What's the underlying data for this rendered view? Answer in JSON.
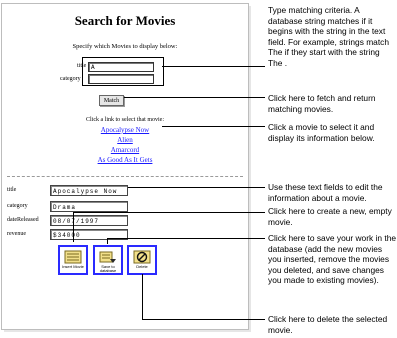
{
  "form": {
    "title": "Search for Movies",
    "specify_text": "Specify which Movies to display below:",
    "title_label": "title",
    "title_value": "A",
    "category_label": "category",
    "category_value": "",
    "match_label": "Match",
    "click_link_text": "Click a link to select that movie:",
    "movies": [
      "Apocalypse Now",
      "Alien",
      "Amarcord",
      "As Good As It Gets"
    ]
  },
  "details": {
    "fields": [
      {
        "label": "title",
        "value": "Apocalypse Now"
      },
      {
        "label": "category",
        "value": "Drama"
      },
      {
        "label": "dateReleased",
        "value": "08/07/1997"
      },
      {
        "label": "revenue",
        "value": "$34000"
      }
    ],
    "buttons": [
      {
        "caption": "Insert Movie",
        "icon": "insert-movie-icon"
      },
      {
        "caption": "Save to database",
        "icon": "save-to-database-icon"
      },
      {
        "caption": "Delete",
        "icon": "delete-icon"
      }
    ]
  },
  "annotations": [
    "Type matching criteria. A database string matches if it begins with the string in the text field. For example, strings match  The  if they start with the string  The .",
    "Click here to fetch and return matching movies.",
    "Click a movie to select it and display its information below.",
    "Use these text fields to edit the information about a movie.",
    "Click here to create a new, empty movie.",
    "Click here to save your work in the database (add the new movies you inserted, remove the movies you deleted, and save changes you made to existing movies).",
    "Click here to delete the selected movie."
  ],
  "colors": {
    "link": "#1a1aff",
    "button_border": "#2a2aff"
  }
}
